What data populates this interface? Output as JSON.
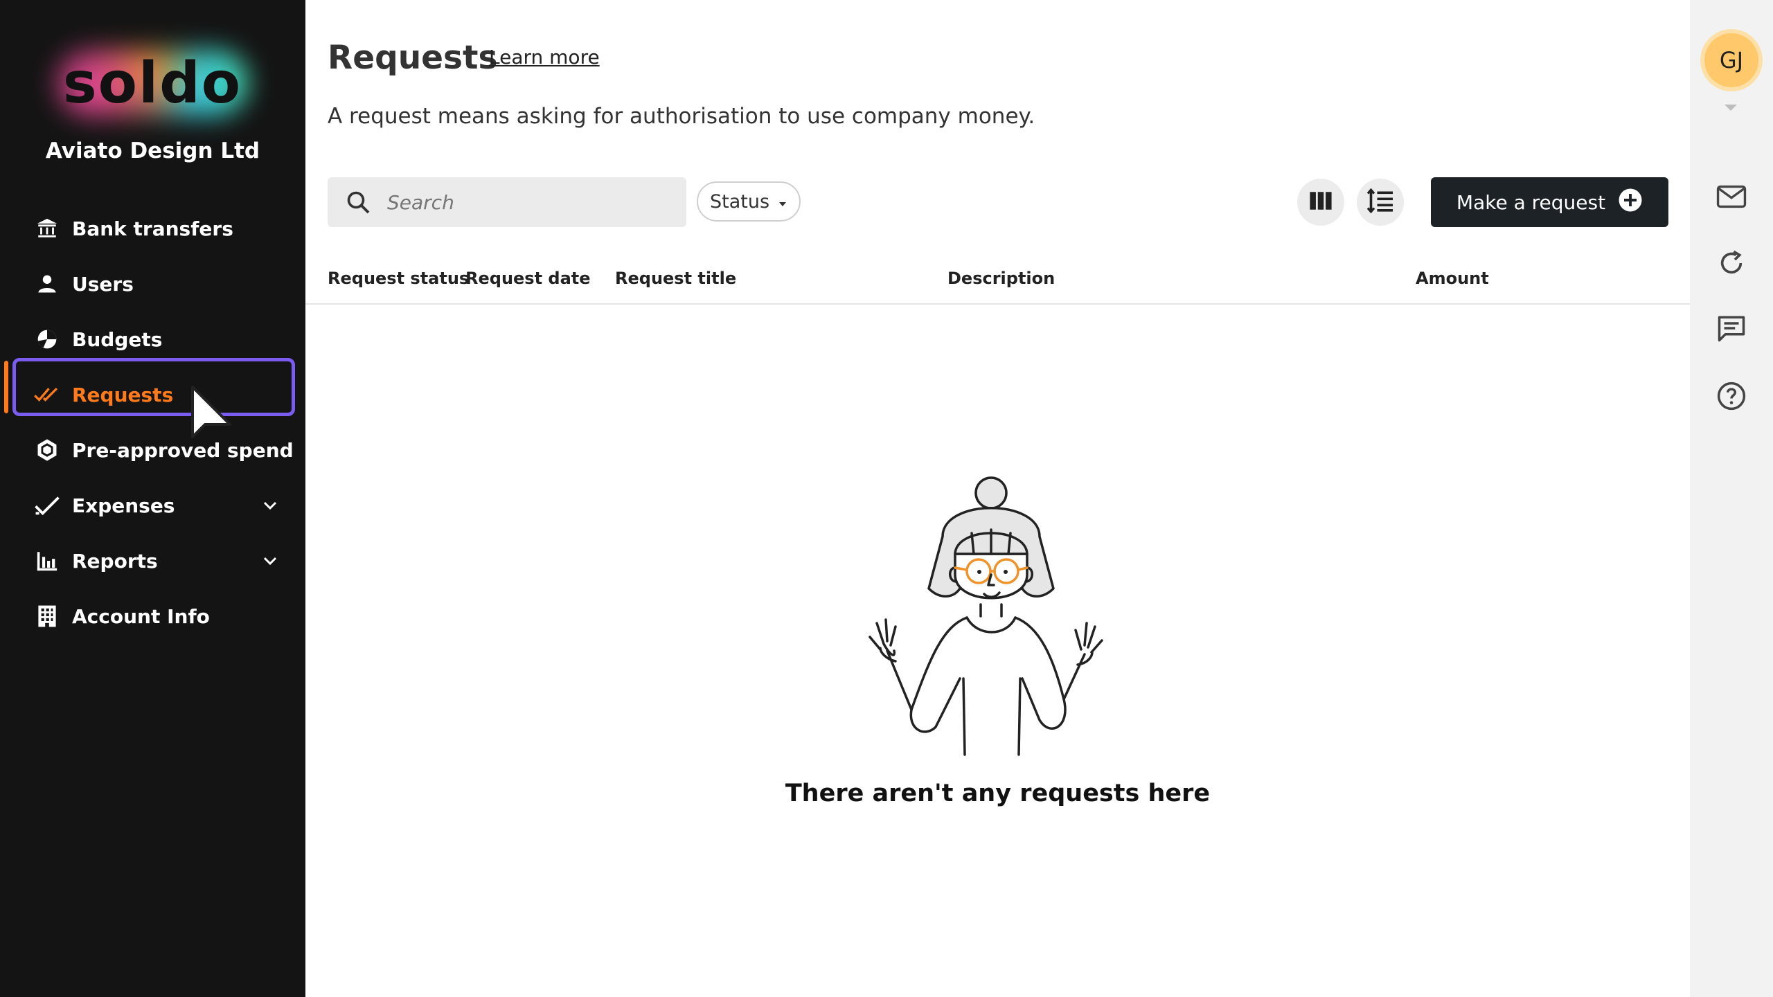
{
  "sidebar": {
    "logo_text": "soldo",
    "company": "Aviato Design Ltd",
    "items": [
      {
        "label": "Bank transfers",
        "icon": "bank-icon"
      },
      {
        "label": "Users",
        "icon": "user-icon"
      },
      {
        "label": "Budgets",
        "icon": "pie-chart-icon"
      },
      {
        "label": "Requests",
        "icon": "double-check-icon",
        "active": true
      },
      {
        "label": "Pre-approved spend",
        "icon": "hexagon-icon"
      },
      {
        "label": "Expenses",
        "icon": "check-icon",
        "expandable": true
      },
      {
        "label": "Reports",
        "icon": "bar-chart-icon",
        "expandable": true
      },
      {
        "label": "Account Info",
        "icon": "building-icon"
      }
    ]
  },
  "page": {
    "title": "Requests",
    "learn_more": "Learn more",
    "subtitle": "A request means asking for authorisation to use company money."
  },
  "toolbar": {
    "search_placeholder": "Search",
    "status_label": "Status",
    "make_request_label": "Make a request"
  },
  "table": {
    "columns": [
      "Request status",
      "Request date",
      "Request title",
      "Description",
      "Amount"
    ]
  },
  "empty_state": {
    "message": "There aren't any requests here"
  },
  "rail": {
    "avatar_initials": "GJ"
  },
  "colors": {
    "sidebar_bg": "#141414",
    "accent_orange": "#ff7a1a",
    "focus_purple": "#7b5cf0",
    "avatar_bg": "#ffc96b",
    "primary_button": "#1d2227"
  }
}
